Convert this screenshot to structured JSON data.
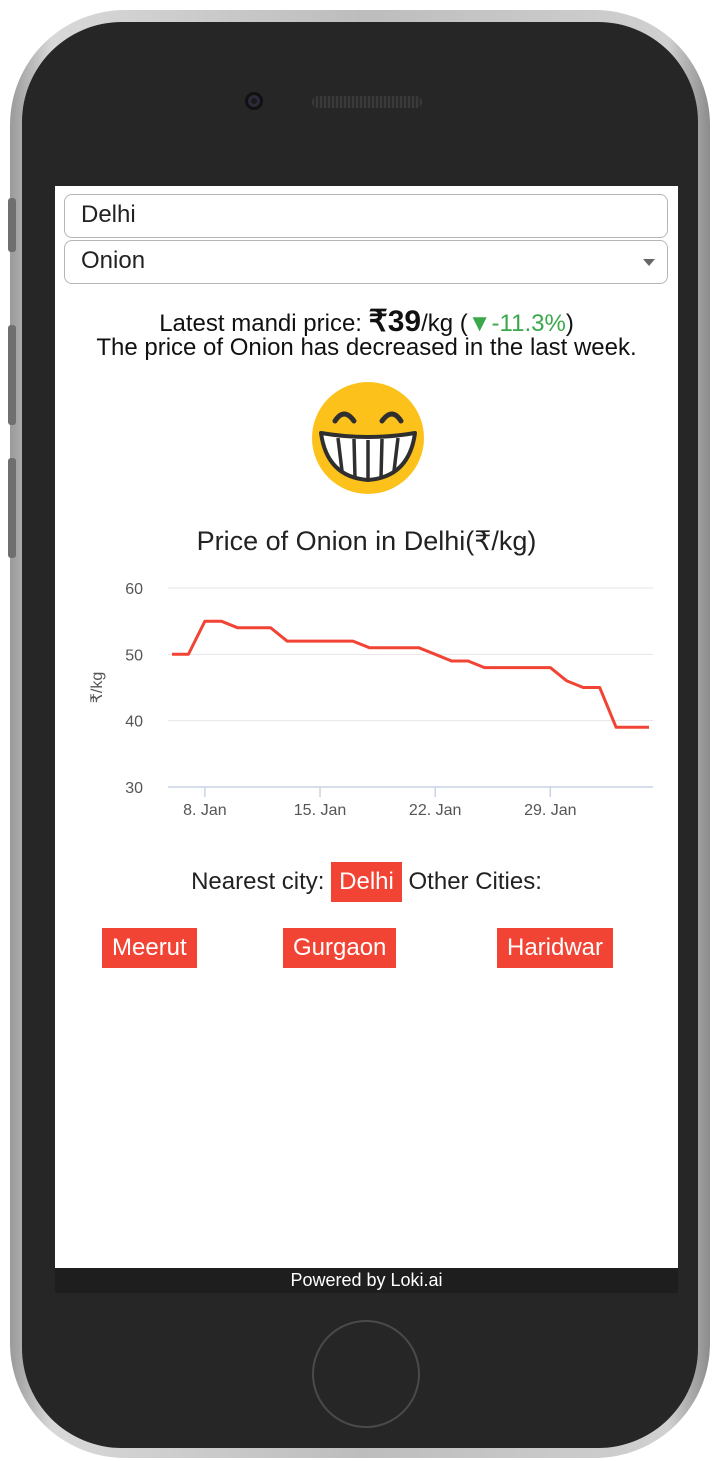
{
  "location_input": {
    "value": "Delhi"
  },
  "commodity_select": {
    "value": "Onion"
  },
  "price_summary": {
    "prefix": "Latest mandi price: ",
    "price": "₹39",
    "unit": "/kg (",
    "arrow": "▼",
    "change": "-11.3%",
    "suffix": ")",
    "description": "The price of Onion has decreased in the last week."
  },
  "mood_icon": "grinning-face-icon",
  "chart_title": "Price of Onion in Delhi(₹/kg)",
  "chart_data": {
    "type": "line",
    "title": "Price of Onion in Delhi(₹/kg)",
    "xlabel": "",
    "ylabel": "₹/kg",
    "ylim": [
      30,
      60
    ],
    "yticks": [
      "30",
      "40",
      "50",
      "60"
    ],
    "xticks": [
      "8. Jan",
      "15. Jan",
      "22. Jan",
      "29. Jan"
    ],
    "grid": true,
    "series": [
      {
        "color": "#f14434",
        "x": [
          "6 Jan",
          "7 Jan",
          "8 Jan",
          "9 Jan",
          "10 Jan",
          "11 Jan",
          "12 Jan",
          "13 Jan",
          "14 Jan",
          "15 Jan",
          "16 Jan",
          "17 Jan",
          "18 Jan",
          "19 Jan",
          "20 Jan",
          "21 Jan",
          "22 Jan",
          "23 Jan",
          "24 Jan",
          "25 Jan",
          "26 Jan",
          "27 Jan",
          "28 Jan",
          "29 Jan",
          "30 Jan",
          "31 Jan",
          "1 Feb",
          "2 Feb",
          "3 Feb",
          "4 Feb"
        ],
        "values": [
          50,
          50,
          55,
          55,
          54,
          54,
          54,
          52,
          52,
          52,
          52,
          52,
          51,
          51,
          51,
          51,
          50,
          49,
          49,
          48,
          48,
          48,
          48,
          48,
          46,
          45,
          45,
          39,
          39,
          39
        ]
      }
    ]
  },
  "nearest": {
    "label": "Nearest city:",
    "city": "Delhi",
    "other_label": "Other Cities:"
  },
  "other_cities": [
    "Meerut",
    "Gurgaon",
    "Haridwar"
  ],
  "footer": "Powered by Loki.ai"
}
